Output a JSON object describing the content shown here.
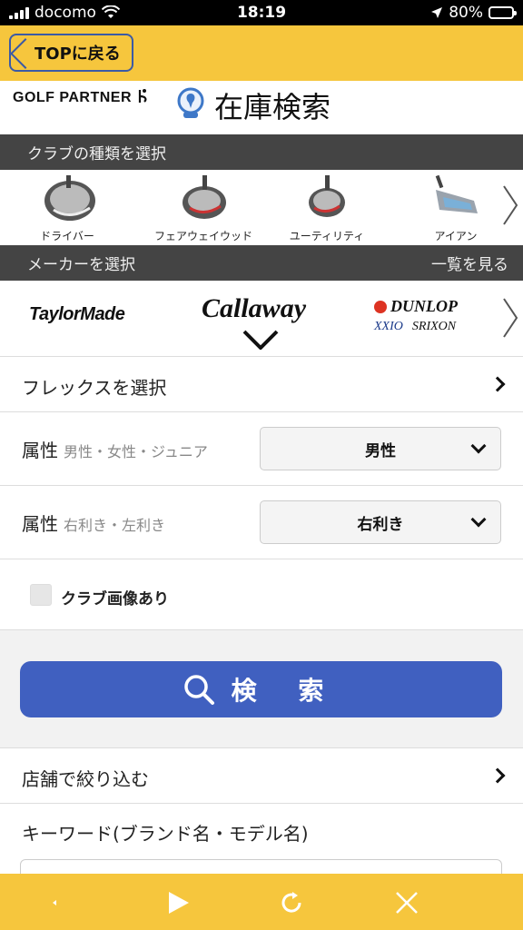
{
  "status_bar": {
    "carrier": "docomo",
    "time": "18:19",
    "battery": "80%",
    "battery_level": 0.8
  },
  "header": {
    "back_label": "TOPに戻る"
  },
  "logo": {
    "brand": "GOLF PARTNER",
    "title": "在庫検索"
  },
  "club_section": {
    "title": "クラブの種類を選択",
    "items": [
      {
        "label": "ドライバー"
      },
      {
        "label": "フェアウェイウッド"
      },
      {
        "label": "ユーティリティ"
      },
      {
        "label": "アイアン"
      }
    ]
  },
  "maker_section": {
    "title": "メーカーを選択",
    "link": "一覧を見る",
    "makers": [
      {
        "name": "TaylorMade"
      },
      {
        "name": "Callaway"
      },
      {
        "name": "DUNLOP",
        "sub1": "XXIO",
        "sub2": "SRIXON"
      }
    ]
  },
  "flex": {
    "label": "フレックスを選択"
  },
  "gender": {
    "label": "属性",
    "sub": "男性・女性・ジュニア",
    "value": "男性"
  },
  "hand": {
    "label": "属性",
    "sub": "右利き・左利き",
    "value": "右利き"
  },
  "image_filter": {
    "label": "クラブ画像あり"
  },
  "search": {
    "label": "検 索"
  },
  "store": {
    "label": "店舗で絞り込む"
  },
  "keyword": {
    "label": "キーワード(ブランド名・モデル名)"
  },
  "colors": {
    "accent": "#f6c63d",
    "primary": "#4060c0",
    "section": "#444444"
  }
}
